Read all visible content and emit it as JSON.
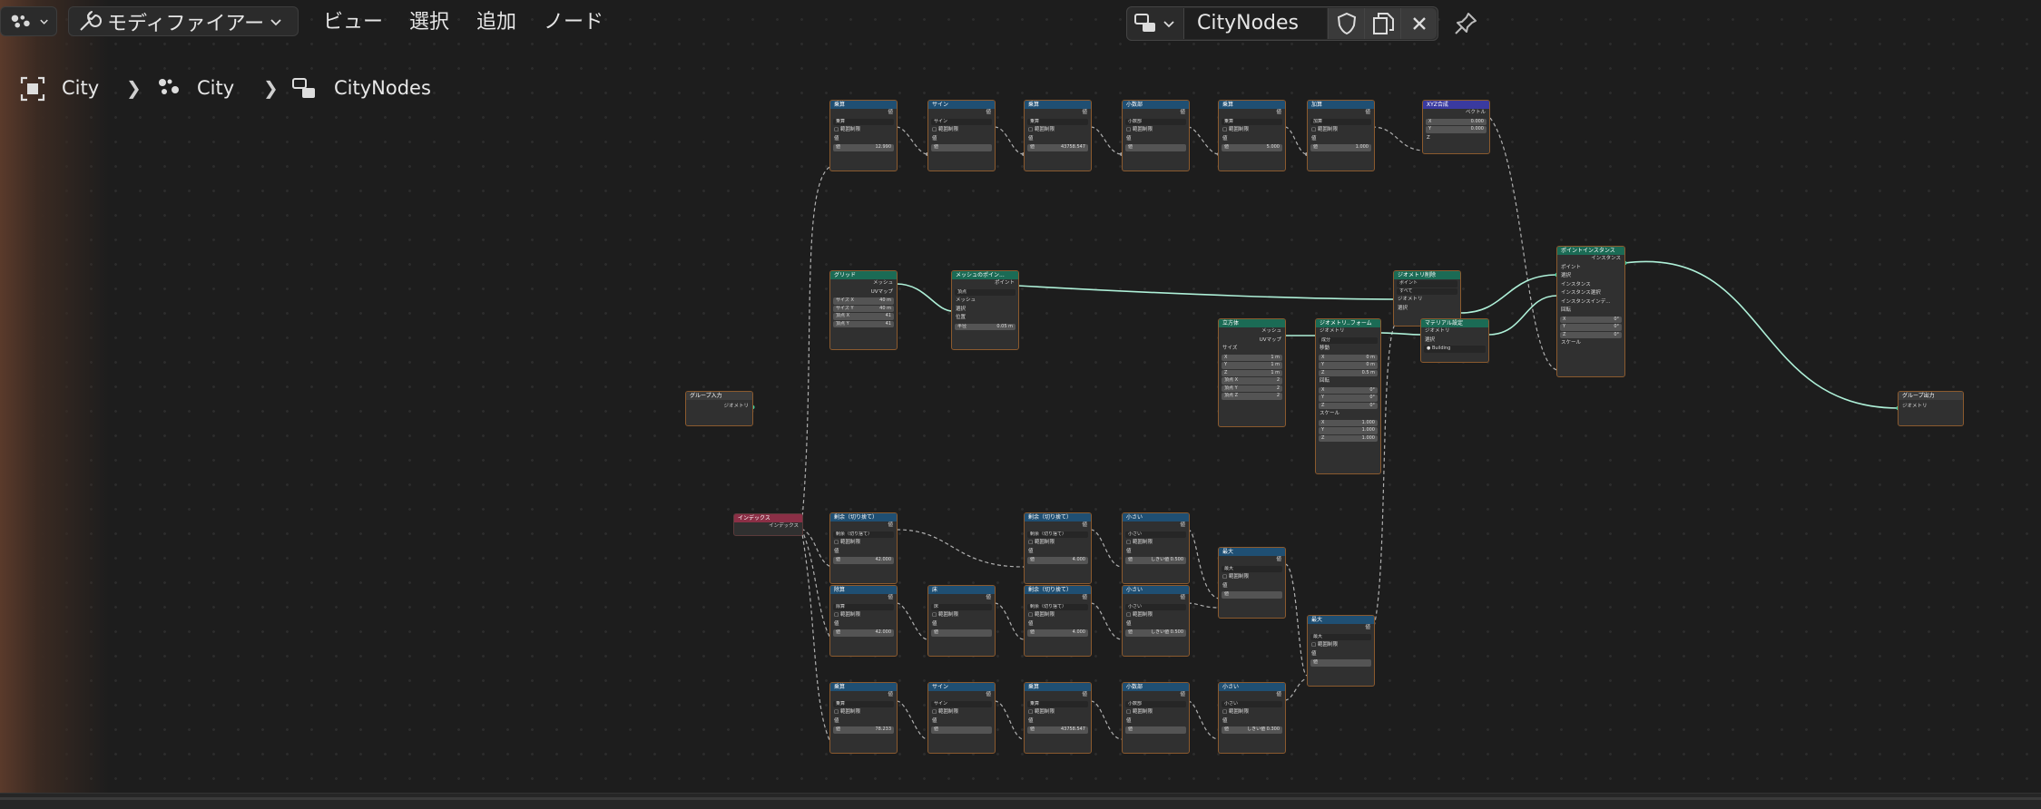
{
  "header": {
    "menus": [
      "ビュー",
      "選択",
      "追加",
      "ノード"
    ],
    "editor_mode": "モディファイアー",
    "node_tree_name": "CityNodes"
  },
  "breadcrumb": {
    "items": [
      "City",
      "City",
      "CityNodes"
    ]
  },
  "nodes": {
    "group_input": {
      "title": "グループ入力",
      "out": "ジオメトリ"
    },
    "group_output": {
      "title": "グループ出力",
      "in": "ジオメトリ"
    },
    "index": {
      "title": "インデックス",
      "out": "インデックス"
    },
    "grid": {
      "title": "グリッド",
      "mesh": "メッシュ",
      "uv": "UVマップ",
      "sx": "サイズ X",
      "sx_v": "40 m",
      "sy": "サイズ Y",
      "sy_v": "40 m",
      "vx": "頂点 X",
      "vx_v": "41",
      "vy": "頂点 Y",
      "vy_v": "41"
    },
    "mesh_to_points": {
      "title": "メッシュのポイン...",
      "out": "ポイント",
      "mode": "頂点",
      "in1": "メッシュ",
      "in2": "選択",
      "in3": "位置",
      "radius": "半径",
      "radius_v": "0.05 m"
    },
    "instance_on_points": {
      "title": "ポイントインスタンス",
      "out": "インスタンス",
      "s1": "ポイント",
      "s2": "選択",
      "s3": "インスタンス",
      "s4": "インスタンス選択",
      "s5": "インスタンスインデ...",
      "s6": "回転",
      "rx": "0°",
      "ry": "0°",
      "rz": "0°",
      "s7": "スケール"
    },
    "join": {
      "title": "ジオメトリ削除",
      "mode": "ポイント",
      "mode2": "すべて",
      "in1": "ジオメトリ",
      "in2": "選択"
    },
    "set_material": {
      "title": "マテリアル設定",
      "in1": "ジオメトリ",
      "in2": "選択",
      "mat": "Building"
    },
    "transform": {
      "title": "ジオメトリ..フォーム",
      "in": "ジオメトリ",
      "mode": "成分",
      "t": "移動",
      "tx": "0 m",
      "ty": "0 m",
      "tz": "0.5 m",
      "r": "回転",
      "rx": "0°",
      "ry": "0°",
      "rz": "0°",
      "s": "スケール",
      "sx": "1.000",
      "sy": "1.000",
      "sz": "1.000"
    },
    "cube": {
      "title": "立方体",
      "mesh": "メッシュ",
      "uv": "UVマップ",
      "size": "サイズ",
      "x": "1 m",
      "y": "1 m",
      "z": "1 m",
      "vx": "2",
      "vy": "2",
      "vz": "2",
      "vlabel_x": "頂点 X",
      "vlabel_y": "頂点 Y",
      "vlabel_z": "頂点 Z"
    },
    "combine_xyz": {
      "title": "XYZ合成",
      "out": "ベクトル",
      "x": "0.000",
      "y": "0.000",
      "z": "Z"
    },
    "math_common": {
      "val": "値",
      "clamp": "範囲制限"
    },
    "top": [
      {
        "title": "乗算",
        "op": "乗算",
        "v": "12.990"
      },
      {
        "title": "サイン",
        "op": "サイン",
        "v": ""
      },
      {
        "title": "乗算",
        "op": "乗算",
        "v": "43758.547"
      },
      {
        "title": "小数部",
        "op": "小数部",
        "v": ""
      },
      {
        "title": "乗算",
        "op": "乗算",
        "v": "5.000"
      },
      {
        "title": "加算",
        "op": "加算",
        "v": "1.000"
      }
    ],
    "row1": [
      {
        "title": "剰余（切り捨て）",
        "op": "剰余（切り捨て）",
        "v": "42.000"
      },
      {
        "title": "剰余（切り捨て）",
        "op": "剰余（切り捨て）",
        "v": "4.000"
      },
      {
        "title": "小さい",
        "op": "小さい",
        "v": "しきい値 0.500"
      },
      {
        "title": "最大",
        "op": "最大",
        "v": ""
      }
    ],
    "row2": [
      {
        "title": "除算",
        "op": "除算",
        "v": "42.000"
      },
      {
        "title": "床",
        "op": "床",
        "v": ""
      },
      {
        "title": "剰余（切り捨て）",
        "op": "剰余（切り捨て）",
        "v": "4.000"
      },
      {
        "title": "小さい",
        "op": "小さい",
        "v": "しきい値 0.500"
      },
      {
        "title": "最大",
        "op": "最大",
        "v": ""
      }
    ],
    "row3": [
      {
        "title": "乗算",
        "op": "乗算",
        "v": "78.233"
      },
      {
        "title": "サイン",
        "op": "サイン",
        "v": ""
      },
      {
        "title": "乗算",
        "op": "乗算",
        "v": "43758.547"
      },
      {
        "title": "小数部",
        "op": "小数部",
        "v": ""
      },
      {
        "title": "小さい",
        "op": "小さい",
        "v": "しきい値 0.300"
      }
    ]
  },
  "colors": {
    "accent_frame": "#8b5a2e",
    "math_header": "#1f4f73",
    "geometry_header": "#1b6b55",
    "input_header": "#8b2f46",
    "link_geometry": "#aef0d8",
    "link_value": "#c9c9c9"
  }
}
